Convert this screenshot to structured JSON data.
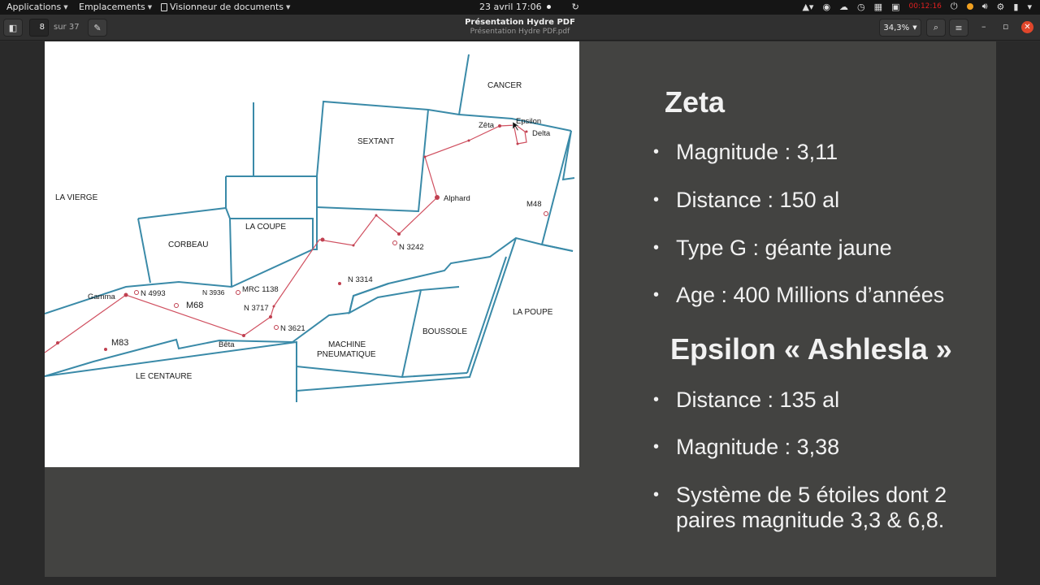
{
  "topbar": {
    "applications": "Applications",
    "places": "Emplacements",
    "app_menu": "Visionneur de documents",
    "datetime": "23 avril  17:06",
    "rec_time": "00:12:16"
  },
  "header": {
    "page_current": "8",
    "page_total": "sur 37",
    "title": "Présentation Hydre PDF",
    "subtitle": "Présentation Hydre PDF.pdf",
    "zoom": "34,3%"
  },
  "map": {
    "regions": {
      "cancer": "CANCER",
      "sextant": "SEXTANT",
      "la_vierge": "LA VIERGE",
      "la_coupe": "LA COUPE",
      "corbeau": "CORBEAU",
      "la_poupe": "LA POUPE",
      "boussole": "BOUSSOLE",
      "machine_1": "MACHINE",
      "machine_2": "PNEUMATIQUE",
      "le_centaure": "LE CENTAURE"
    },
    "stars": {
      "zeta": "Zêta",
      "epsilon": "Epsilon",
      "delta": "Delta",
      "alphard": "Alphard",
      "m48": "M48",
      "n3242": "N 3242",
      "n3314": "N 3314",
      "n4993": "N 4993",
      "n3936": "N 3936",
      "mrc1138": "MRC 1138",
      "n3717": "N 3717",
      "n3621": "N 3621",
      "gamma": "Gamma",
      "m68": "M68",
      "m83": "M83",
      "beta": "Bêta"
    }
  },
  "slide": {
    "zeta_title": "Zeta",
    "zeta_items": [
      "Magnitude : 3,11",
      "Distance : 150 al",
      "Type G : géante jaune",
      "Age : 400 Millions d’années"
    ],
    "epsilon_title": "Epsilon « Ashlesla »",
    "epsilon_items": [
      "Distance : 135 al",
      "Magnitude : 3,38",
      "Système de 5 étoiles dont 2",
      "paires magnitude 3,3 & 6,8."
    ],
    "bullet": "•"
  },
  "colors": {
    "boundary": "#3a8aa8",
    "hydra_line": "#d05060",
    "slide_bg": "#434341"
  }
}
